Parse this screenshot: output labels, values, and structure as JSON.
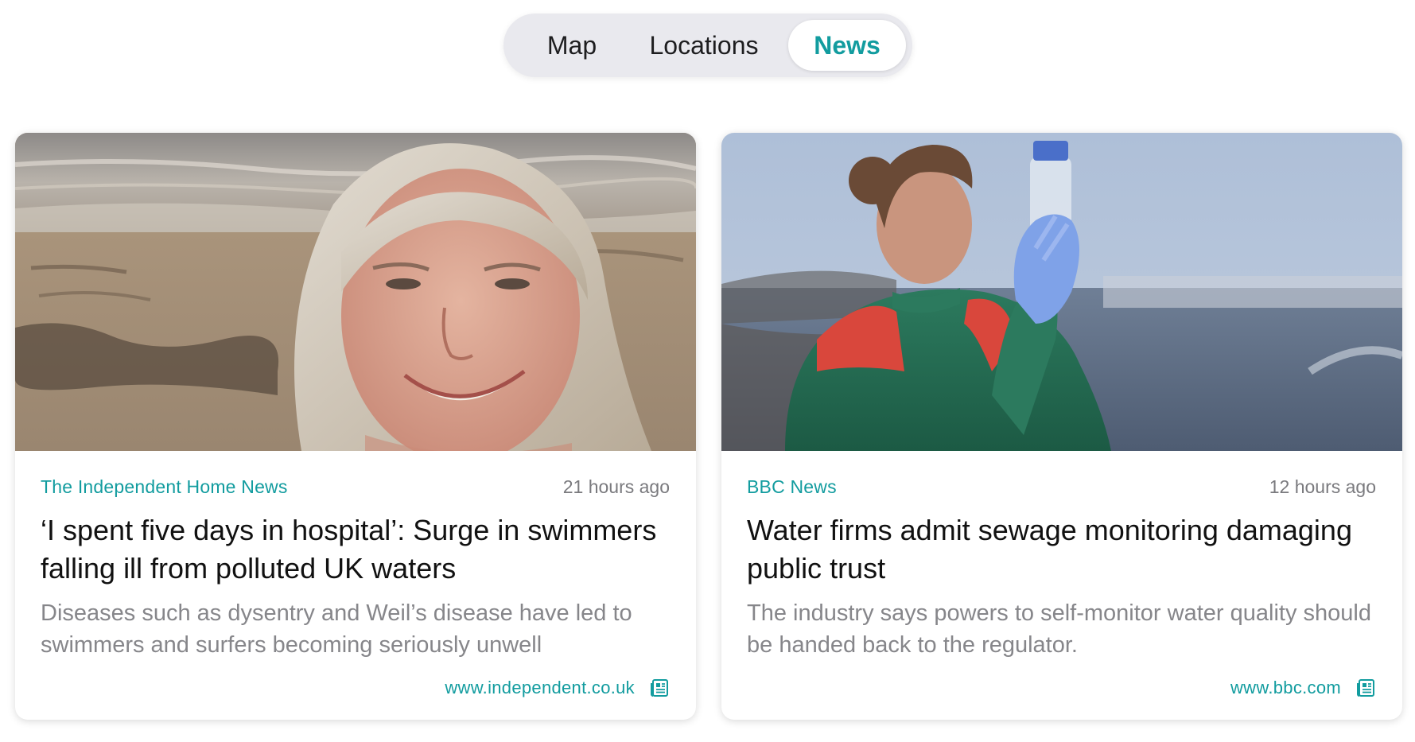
{
  "segmented_control": {
    "tabs": [
      {
        "label": "Map",
        "selected": false
      },
      {
        "label": "Locations",
        "selected": false
      },
      {
        "label": "News",
        "selected": true
      }
    ]
  },
  "articles": [
    {
      "source": "The Independent Home News",
      "time": "21 hours ago",
      "headline": "‘I spent five days in hospital’: Surge in swimmers falling ill from polluted UK waters",
      "description": "Diseases such as dysentry and Weil’s disease have led to swimmers and surfers becoming seriously unwell",
      "link": "www.independent.co.uk",
      "icon": "newspaper-icon"
    },
    {
      "source": "BBC News",
      "time": "12 hours ago",
      "headline": "Water firms admit sewage monitoring damaging public trust",
      "description": "The industry says powers to self-monitor water quality should be handed back to the regulator.",
      "link": "www.bbc.com",
      "icon": "newspaper-icon"
    }
  ],
  "colors": {
    "accent": "#129c9f",
    "segment_bg": "#e9e9ee",
    "muted_text": "#86868a"
  }
}
